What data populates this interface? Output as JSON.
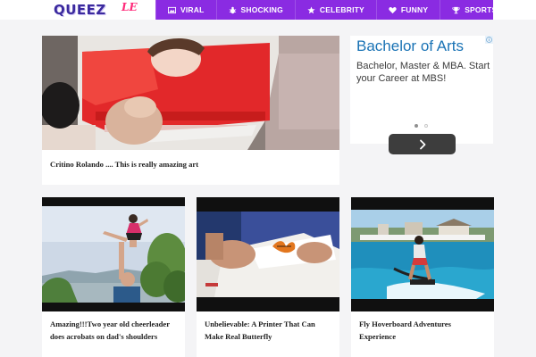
{
  "logo": {
    "main": "QUEEZ",
    "suffix": "LE"
  },
  "nav": [
    {
      "label": "VIRAL",
      "icon": "image-icon"
    },
    {
      "label": "SHOCKING",
      "icon": "bug-icon"
    },
    {
      "label": "CELEBRITY",
      "icon": "star-icon"
    },
    {
      "label": "FUNNY",
      "icon": "heart-icon"
    },
    {
      "label": "SPORTS",
      "icon": "trophy-icon"
    }
  ],
  "featured": {
    "title": "Critino Rolando .... This is really amazing art"
  },
  "ad": {
    "title": "Bachelor of Arts",
    "text": "Bachelor, Master & MBA. Start your Career at MBS!",
    "button_icon": "chevron-right-icon",
    "corner_icon": "adchoices-icon"
  },
  "posts": [
    {
      "title": "Amazing!!!Two year old cheerleader does acrobats on dad's shoulders"
    },
    {
      "title": "Unbelievable: A Printer That Can Make Real Butterfly"
    },
    {
      "title": "Fly Hoverboard Adventures Experience"
    }
  ],
  "colors": {
    "nav_bg": "#8a2be2",
    "ad_title": "#1a73b5",
    "logo": "#3b2a9e",
    "logo_suffix": "#ff2a7a"
  }
}
